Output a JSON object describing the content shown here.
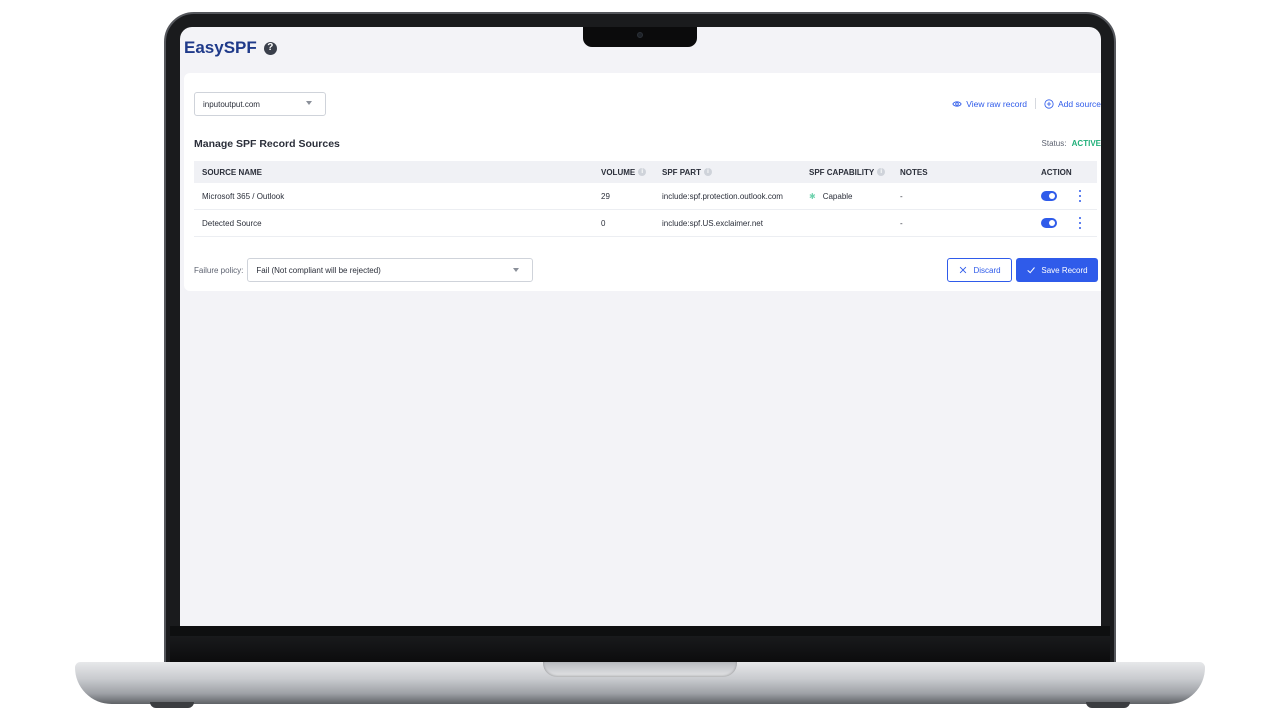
{
  "app": {
    "title": "EasySPF",
    "help_glyph": "?"
  },
  "domain_select": {
    "value": "inputoutput.com"
  },
  "actions": {
    "view_raw": "View raw record",
    "add_source": "Add source"
  },
  "section": {
    "title": "Manage SPF Record Sources",
    "status_label": "Status:",
    "status_value": "ACTIVE"
  },
  "table": {
    "headers": {
      "source_name": "SOURCE NAME",
      "volume": "VOLUME",
      "spf_part": "SPF PART",
      "spf_capability": "SPF CAPABILITY",
      "notes": "NOTES",
      "action": "ACTION"
    },
    "rows": [
      {
        "source_name": "Microsoft 365 / Outlook",
        "volume": "29",
        "spf_part": "include:spf.protection.outlook.com",
        "capability": "Capable",
        "notes": "-",
        "enabled": true
      },
      {
        "source_name": "Detected Source",
        "volume": "0",
        "spf_part": "include:spf.US.exclaimer.net",
        "capability": "",
        "notes": "-",
        "enabled": true
      }
    ]
  },
  "failure_policy": {
    "label": "Failure policy:",
    "value": "Fail (Not compliant will be rejected)"
  },
  "buttons": {
    "discard": "Discard",
    "save": "Save Record"
  },
  "colors": {
    "accent": "#2f5bea",
    "brand": "#1f3a8a",
    "active": "#21b07a"
  },
  "icons": [
    "help-icon",
    "chevron-down-icon",
    "eye-icon",
    "plus-circle-icon",
    "info-icon",
    "toggle-icon",
    "kebab-menu-icon",
    "close-icon",
    "check-icon"
  ]
}
